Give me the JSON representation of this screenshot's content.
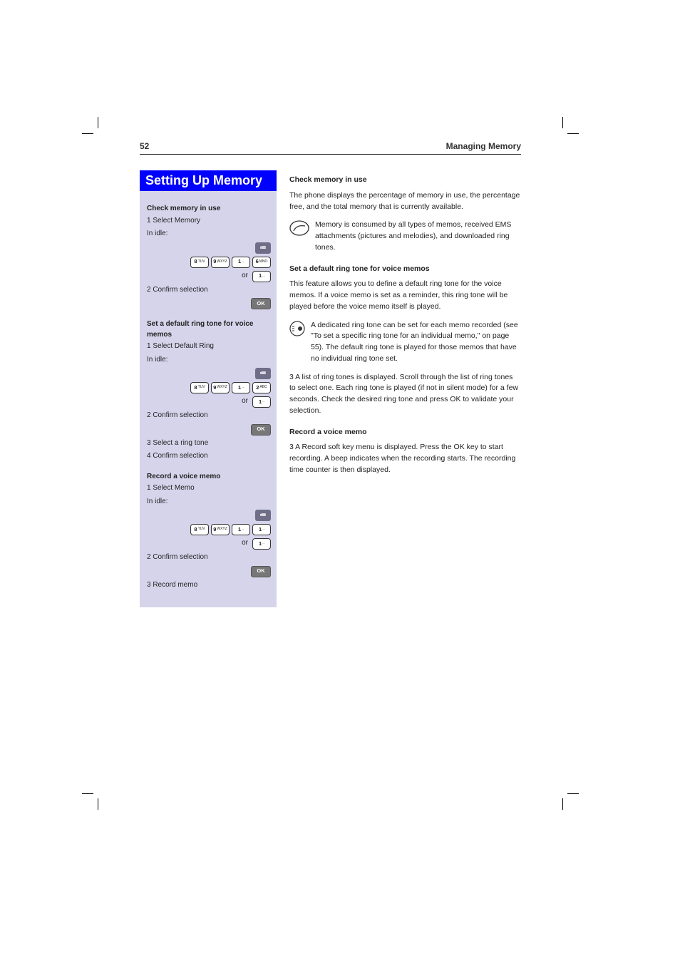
{
  "header": {
    "page_number": "52",
    "chapter": "Managing Memory"
  },
  "section": {
    "title": "Setting Up Memory"
  },
  "left": {
    "block1": {
      "title": "Check memory in use",
      "step1_label": "1 Select Memory",
      "step1_text": "In idle:",
      "key_row1": [
        "8 TUV",
        "9 WXYZ",
        "1 ..",
        "6 MNO"
      ],
      "or_row": [
        "or",
        "1 .."
      ],
      "step2_label": "2 Confirm selection",
      "ok": "OK"
    },
    "block2": {
      "title": "Set a default ring tone for voice memos",
      "step1_label": "1 Select Default Ring",
      "step1_text": "In idle:",
      "key_row1": [
        "8 TUV",
        "9 WXYZ",
        "1 ..",
        "2 ABC"
      ],
      "or_row": [
        "or",
        "1 .."
      ],
      "step2_label": "2 Confirm selection",
      "ok": "OK",
      "step3_label": "3 Select a ring tone",
      "step4_label": "4 Confirm selection"
    },
    "block3": {
      "title": "Record a voice memo",
      "step1_label": "1 Select Memo",
      "step1_text": "In idle:",
      "key_row1": [
        "8 TUV",
        "9 WXYZ",
        "1 ..",
        "1 .."
      ],
      "or_row": [
        "or",
        "1 .."
      ],
      "step2_label": "2 Confirm selection",
      "ok": "OK",
      "step3_label": "3 Record memo"
    }
  },
  "right": {
    "b1": {
      "title": "Check memory in use",
      "p1": "The phone displays the percentage of memory in use, the percentage free, and the total memory that is currently available.",
      "note": "Memory is consumed by all types of memos, received EMS attachments (pictures and melodies), and downloaded ring tones."
    },
    "b2": {
      "title": "Set a default ring tone for voice memos",
      "p1": "This feature allows you to define a default ring tone for the voice memos. If a voice memo is set as a reminder, this ring tone will be played before the voice memo itself is played.",
      "note": "A dedicated ring tone can be set for each memo recorded (see \"To set a specific ring tone for an individual memo,\" on page 55). The default ring tone is played for those memos that have no individual ring tone set.",
      "step3": "3  A list of ring tones is displayed. Scroll through the list of ring tones to select one. Each ring tone is played (if not in silent mode) for a few seconds. Check the desired ring tone and press OK to validate your selection."
    },
    "b3": {
      "title": "Record a voice memo",
      "step3": "3  A Record soft key menu is displayed. Press the OK key to start recording. A beep indicates when the recording starts. The recording time counter is then displayed."
    }
  }
}
